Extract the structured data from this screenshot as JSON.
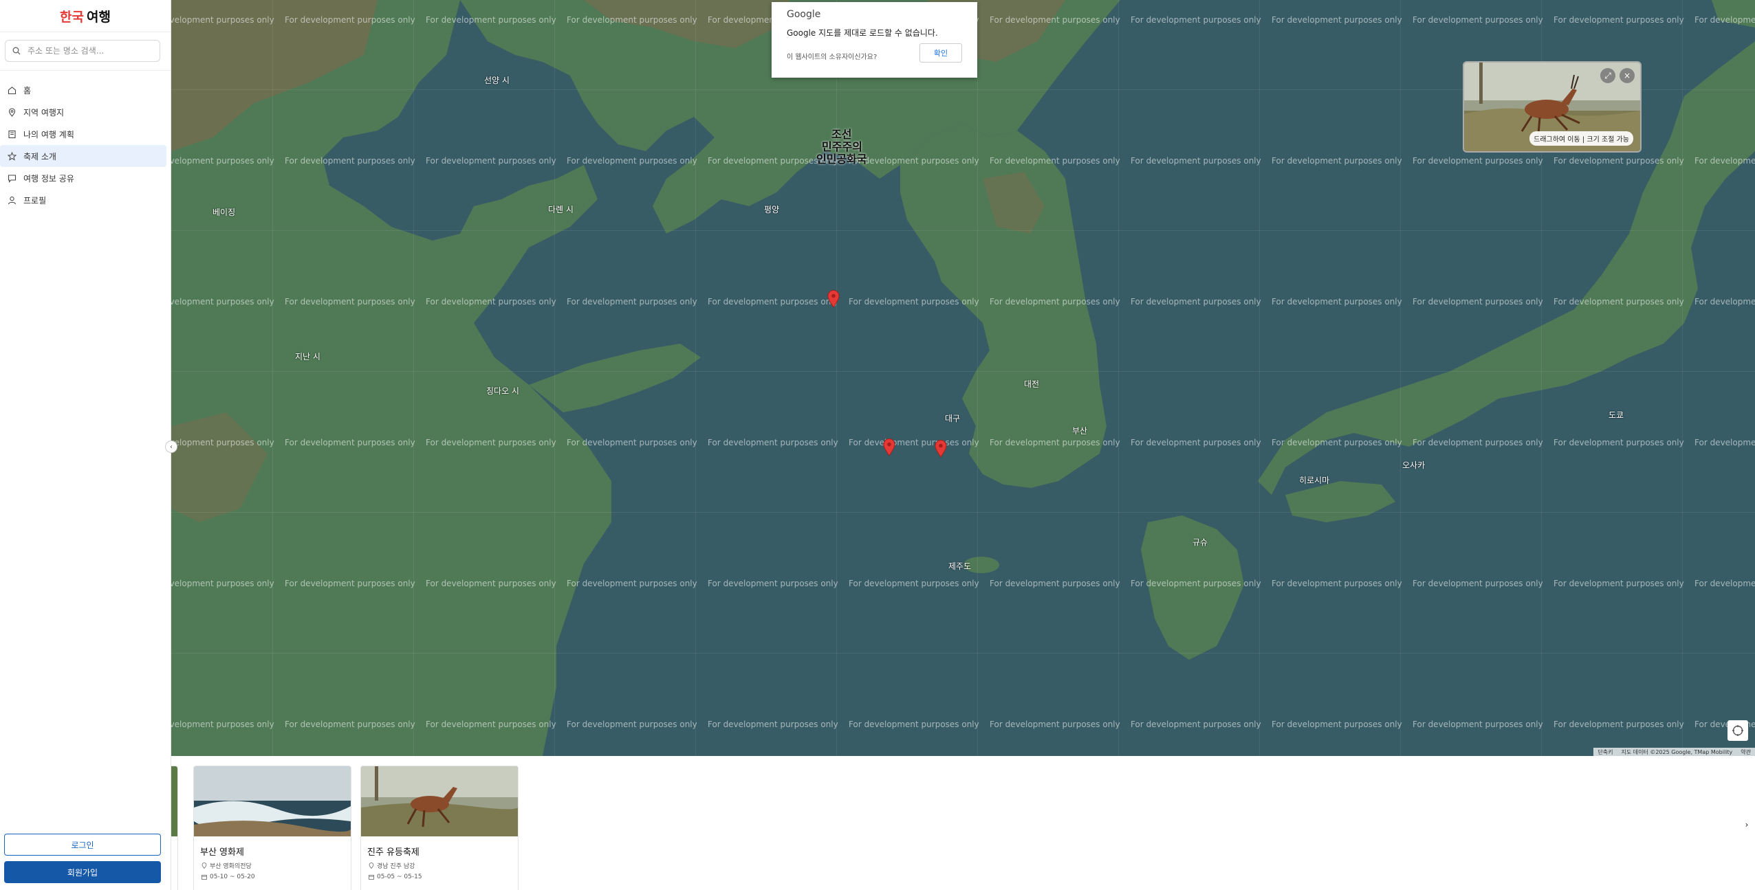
{
  "brand": {
    "part1": "한국",
    "part2": "여행"
  },
  "search": {
    "placeholder": "주소 또는 명소 검색..."
  },
  "nav": {
    "items": [
      {
        "label": "홈",
        "icon": "home-icon"
      },
      {
        "label": "지역 여행지",
        "icon": "map-pin-icon"
      },
      {
        "label": "나의 여행 계획",
        "icon": "book-icon"
      },
      {
        "label": "축제 소개",
        "icon": "star-icon",
        "active": true
      },
      {
        "label": "여행 정보 공유",
        "icon": "chat-icon"
      },
      {
        "label": "프로필",
        "icon": "user-icon"
      }
    ]
  },
  "auth": {
    "login_label": "로그인",
    "signup_label": "회원가입"
  },
  "dialog": {
    "logo": "Google",
    "message": "Google 지도를 제대로 로드할 수 없습니다.",
    "question": "이 웹사이트의 소유자이신가요?",
    "ok_label": "확인"
  },
  "map": {
    "dev_text": "For development purposes only",
    "labels": {
      "north_korea_1": "조선",
      "north_korea_2": "민주주의",
      "north_korea_3": "인민공화국",
      "pyongyang": "평양",
      "busan": "부산",
      "daejeon": "대전",
      "daegu": "대구",
      "hiroshima": "히로시마",
      "osaka": "오사카",
      "tokyo": "도쿄",
      "kyushu": "규슈",
      "jeju": "제주도",
      "dalian": "다롄 시",
      "shenyang": "선양 시",
      "qingdao": "칭다오 시",
      "jinan": "지난 시",
      "beijing": "베이징"
    },
    "attribution": {
      "shortcuts": "단축키",
      "data": "지도 데이터 ©2025 Google, TMap Mobility",
      "terms": "약관"
    }
  },
  "pip": {
    "hint": "드래그하여 이동 | 크기 조절 가능"
  },
  "cards": [
    {
      "title": "부산 영화제",
      "location": "부산 영화의전당",
      "dates": "05-10 ~ 05-20"
    },
    {
      "title": "진주 유등축제",
      "location": "경남 진주 남강",
      "dates": "05-05 ~ 05-15"
    }
  ],
  "colors": {
    "brand_red": "#e53935",
    "primary": "#1558a8",
    "map_water": "#375c66",
    "map_land": "#4f7a55",
    "pin": "#e53935"
  }
}
